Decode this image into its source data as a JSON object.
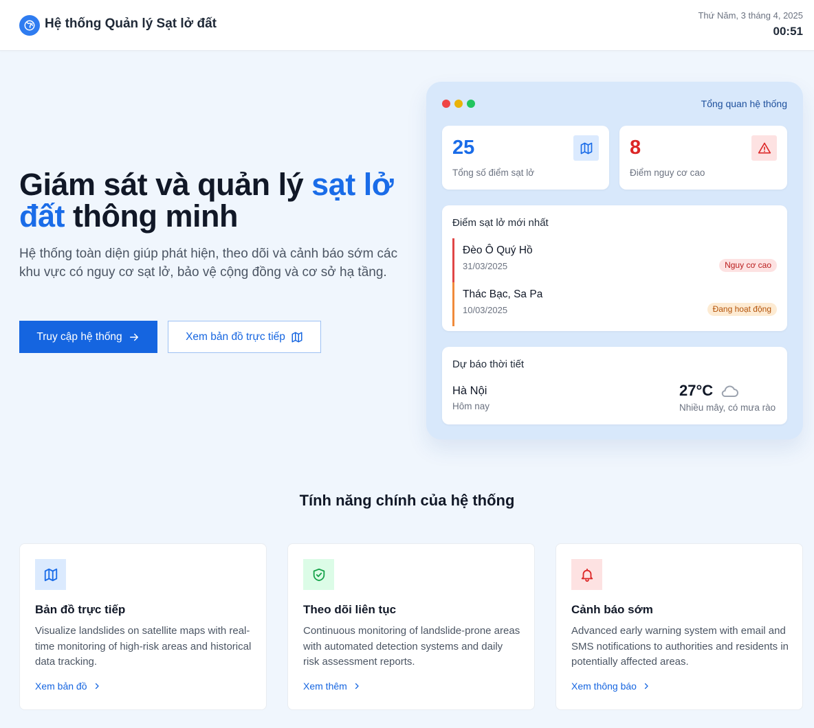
{
  "header": {
    "app_title": "Hệ thống Quản lý Sạt lở đất",
    "date": "Thứ Năm, 3 tháng 4, 2025",
    "time": "00:51"
  },
  "hero": {
    "title_part1": "Giám sát và quản lý ",
    "title_accent": "sạt lở đất",
    "title_part2": " thông minh",
    "description": "Hệ thống toàn diện giúp phát hiện, theo dõi và cảnh báo sớm các khu vực có nguy cơ sạt lở, bảo vệ cộng đồng và cơ sở hạ tầng.",
    "primary_button": "Truy cập hệ thống",
    "secondary_button": "Xem bản đồ trực tiếp"
  },
  "dashboard": {
    "title": "Tổng quan hệ thống",
    "stats": [
      {
        "value": "25",
        "label": "Tổng số điểm sạt lở",
        "color": "#1a6ce8",
        "icon": "map-icon"
      },
      {
        "value": "8",
        "label": "Điểm nguy cơ cao",
        "color": "#dc2626",
        "icon": "warning-icon"
      }
    ],
    "recent": {
      "heading": "Điểm sạt lở mới nhất",
      "items": [
        {
          "name": "Đèo Ô Quý Hồ",
          "date": "31/03/2025",
          "badge": "Nguy cơ cao",
          "accent": "#e04646"
        },
        {
          "name": "Thác Bạc, Sa Pa",
          "date": "10/03/2025",
          "badge": "Đang hoạt động",
          "accent": "#f08a3a"
        }
      ]
    },
    "weather": {
      "heading": "Dự báo thời tiết",
      "city": "Hà Nội",
      "day": "Hôm nay",
      "temp": "27°C",
      "condition": "Nhiều mây, có mưa rào",
      "icon": "cloud-icon"
    }
  },
  "features": {
    "section_title": "Tính năng chính của hệ thống",
    "items": [
      {
        "title": "Bản đồ trực tiếp",
        "description": "Visualize landslides on satellite maps with real-time monitoring of high-risk areas and historical data tracking.",
        "link": "Xem bản đồ",
        "icon": "map-icon"
      },
      {
        "title": "Theo dõi liên tục",
        "description": "Continuous monitoring of landslide-prone areas with automated detection systems and daily risk assessment reports.",
        "link": "Xem thêm",
        "icon": "shield-check-icon"
      },
      {
        "title": "Cảnh báo sớm",
        "description": "Advanced early warning system with email and SMS notifications to authorities and residents in potentially affected areas.",
        "link": "Xem thông báo",
        "icon": "bell-icon"
      }
    ]
  },
  "colors": {
    "brand": "#1565e0",
    "danger": "#dc2626",
    "panel_bg": "#d8e8fb"
  }
}
